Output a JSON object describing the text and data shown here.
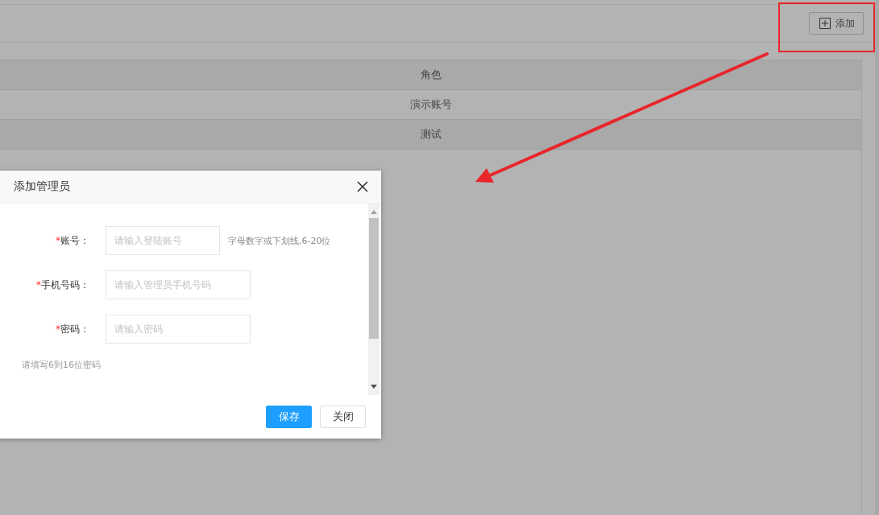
{
  "toolbar": {
    "add_button": {
      "label": "添加"
    }
  },
  "table": {
    "rows": [
      {
        "text": "角色"
      },
      {
        "text": "演示账号"
      },
      {
        "text": "测试"
      }
    ]
  },
  "dialog": {
    "title": "添加管理员",
    "fields": [
      {
        "marker": "*",
        "label": "账号：",
        "placeholder": "请输入登陆账号",
        "hint": "字母数字或下划线,6-20位"
      },
      {
        "marker": "*",
        "label": "手机号码：",
        "placeholder": "请输入管理员手机号码"
      },
      {
        "marker": "*",
        "label": "密码：",
        "placeholder": "请输入密码"
      }
    ],
    "note": "请填写6到16位密码",
    "buttons": [
      {
        "label": "保存",
        "kind": "primary"
      },
      {
        "label": "关闭",
        "kind": "default"
      }
    ]
  }
}
